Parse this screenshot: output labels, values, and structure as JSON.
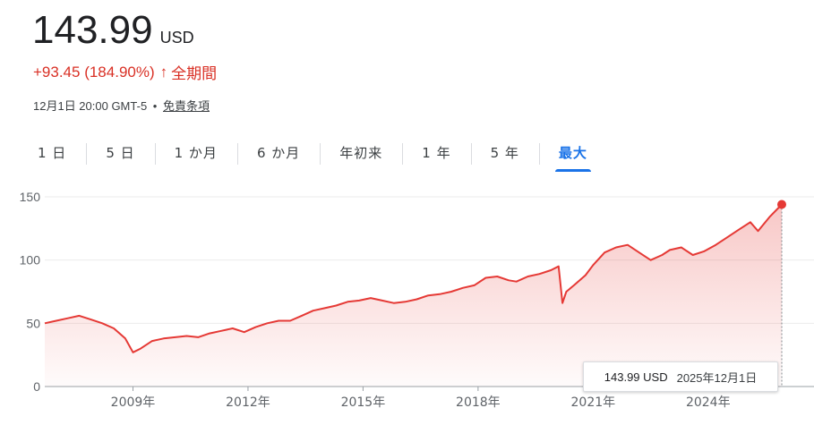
{
  "quote": {
    "price": "143.99",
    "currency": "USD",
    "change": "+93.45 (184.90%)",
    "arrow": "↑",
    "period": "全期間",
    "timestamp": "12月1日 20:00 GMT-5",
    "separator": "•",
    "disclaimer": "免責条項"
  },
  "tabs": [
    {
      "label": "1 日",
      "active": false
    },
    {
      "label": "5 日",
      "active": false
    },
    {
      "label": "1 か月",
      "active": false
    },
    {
      "label": "6 か月",
      "active": false
    },
    {
      "label": "年初来",
      "active": false
    },
    {
      "label": "1 年",
      "active": false
    },
    {
      "label": "5 年",
      "active": false
    },
    {
      "label": "最大",
      "active": true
    }
  ],
  "tooltip": {
    "value": "143.99 USD",
    "date": "2025年12月1日"
  },
  "colors": {
    "line": "#e53935",
    "accent": "#1a73e8",
    "negative": "#d93025"
  },
  "chart_data": {
    "type": "area",
    "x_tick_labels": [
      "2009年",
      "2012年",
      "2015年",
      "2018年",
      "2021年",
      "2024年"
    ],
    "x_tick_years": [
      2009,
      2012,
      2015,
      2018,
      2021,
      2024
    ],
    "y_ticks": [
      0,
      50,
      100,
      150
    ],
    "xlim": [
      2006.7,
      2025.92
    ],
    "ylim": [
      0,
      150
    ],
    "grid": true,
    "series": [
      {
        "x": [
          2006.7,
          2007.0,
          2007.3,
          2007.6,
          2007.9,
          2008.2,
          2008.5,
          2008.8,
          2009.0,
          2009.2,
          2009.5,
          2009.8,
          2010.1,
          2010.4,
          2010.7,
          2011.0,
          2011.3,
          2011.6,
          2011.9,
          2012.2,
          2012.5,
          2012.8,
          2013.1,
          2013.4,
          2013.7,
          2014.0,
          2014.3,
          2014.6,
          2014.9,
          2015.2,
          2015.5,
          2015.8,
          2016.1,
          2016.4,
          2016.7,
          2017.0,
          2017.3,
          2017.6,
          2017.9,
          2018.2,
          2018.5,
          2018.8,
          2019.0,
          2019.3,
          2019.6,
          2019.9,
          2020.1,
          2020.2,
          2020.3,
          2020.5,
          2020.8,
          2021.0,
          2021.3,
          2021.6,
          2021.9,
          2022.2,
          2022.5,
          2022.8,
          2023.0,
          2023.3,
          2023.6,
          2023.9,
          2024.2,
          2024.5,
          2024.8,
          2025.1,
          2025.3,
          2025.6,
          2025.92
        ],
        "y": [
          50,
          52,
          54,
          56,
          53,
          50,
          46,
          38,
          27,
          30,
          36,
          38,
          39,
          40,
          39,
          42,
          44,
          46,
          43,
          47,
          50,
          52,
          52,
          56,
          60,
          62,
          64,
          67,
          68,
          70,
          68,
          66,
          67,
          69,
          72,
          73,
          75,
          78,
          80,
          86,
          87,
          84,
          83,
          87,
          89,
          92,
          95,
          66,
          75,
          80,
          88,
          96,
          106,
          110,
          112,
          106,
          100,
          104,
          108,
          110,
          104,
          107,
          112,
          118,
          124,
          130,
          123,
          134,
          143.99
        ]
      }
    ]
  }
}
